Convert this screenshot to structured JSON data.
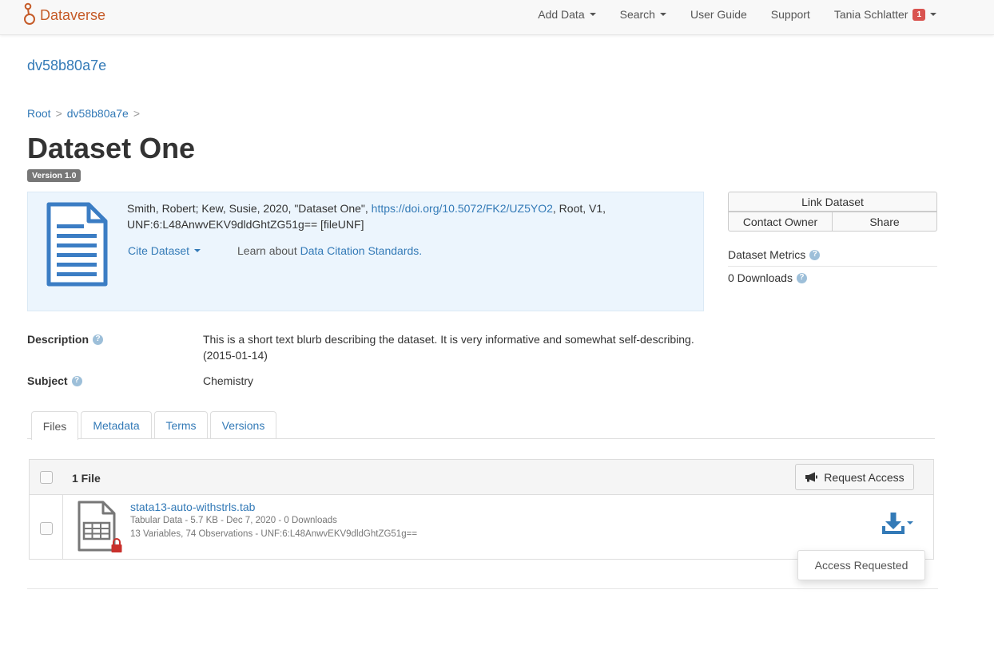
{
  "navbar": {
    "brand": "Dataverse",
    "items": [
      {
        "label": "Add Data",
        "dropdown": true
      },
      {
        "label": "Search",
        "dropdown": true
      },
      {
        "label": "User Guide",
        "dropdown": false
      },
      {
        "label": "Support",
        "dropdown": false
      }
    ],
    "user": {
      "name": "Tania Schlatter",
      "notifications": "1"
    }
  },
  "dataverse_title": "dv58b80a7e",
  "breadcrumb": {
    "root": "Root",
    "sep": ">",
    "dataverse": "dv58b80a7e"
  },
  "dataset": {
    "title": "Dataset One",
    "version": "Version 1.0"
  },
  "citation": {
    "prefix": "Smith, Robert; Kew, Susie, 2020, \"Dataset One\", ",
    "doi": "https://doi.org/10.5072/FK2/UZ5YO2",
    "suffix": ", Root, V1,",
    "unf": "UNF:6:L48AnwvEKV9dldGhtZG51g== [fileUNF]",
    "cite_label": "Cite Dataset",
    "learn_prefix": "Learn about ",
    "learn_link": "Data Citation Standards."
  },
  "actions": {
    "link_dataset": "Link Dataset",
    "contact_owner": "Contact Owner",
    "share": "Share"
  },
  "metrics": {
    "title": "Dataset Metrics",
    "downloads": "0 Downloads"
  },
  "metadata": {
    "description_label": "Description",
    "description_value": "This is a short text blurb describing the dataset. It is very informative and somewhat self-describing. (2015-01-14)",
    "subject_label": "Subject",
    "subject_value": "Chemistry"
  },
  "tabs": [
    "Files",
    "Metadata",
    "Terms",
    "Versions"
  ],
  "files": {
    "count_label": "1 File",
    "request_access": "Request Access",
    "file": {
      "name": "stata13-auto-withstrls.tab",
      "meta1": "Tabular Data - 5.7 KB - Dec 7, 2020 - 0 Downloads",
      "meta2": "13 Variables, 74 Observations - UNF:6:L48AnwvEKV9dldGhtZG51g=="
    },
    "dropdown_item": "Access Requested"
  },
  "colors": {
    "brand": "#c55b28",
    "link": "#337ab7",
    "citation_bg": "#ecf5fd",
    "badge": "#d9534f",
    "lock": "#c9302c"
  }
}
